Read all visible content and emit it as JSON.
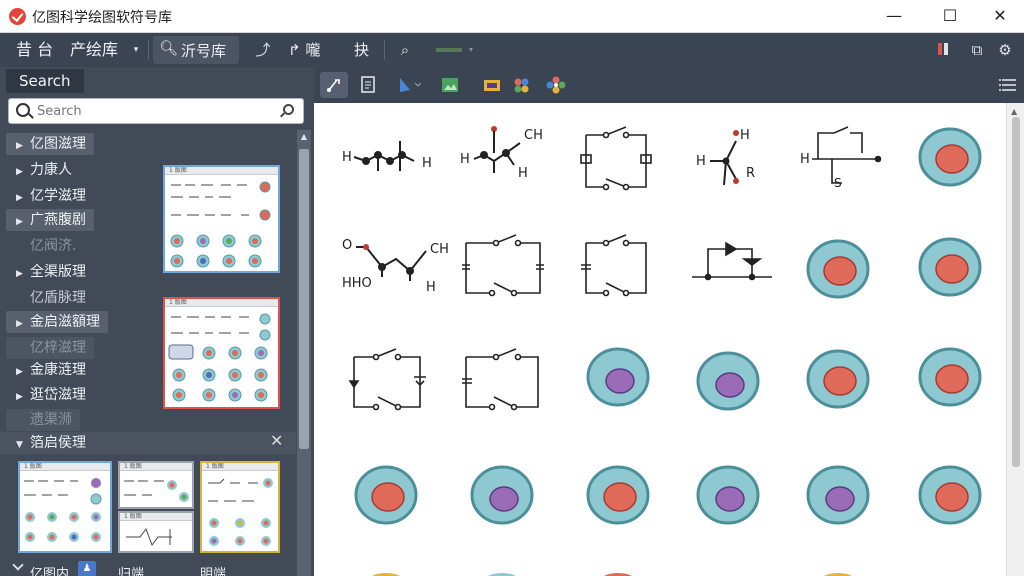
{
  "window": {
    "title": "亿图科学绘图软符号库",
    "minimize": "—",
    "maximize": "☐",
    "close": "✕"
  },
  "toolbar": {
    "menu_1": "昔 台",
    "menu_2": "产绘库",
    "library": "沂号库",
    "item_4": "↱ 嚨",
    "item_5": "抉"
  },
  "left_panel": {
    "search_tab": "Search",
    "search_placeholder": "Search",
    "categories": [
      {
        "label": "亿图滋理",
        "state": "collapsed"
      },
      {
        "label": "力康人",
        "state": "collapsed"
      },
      {
        "label": "亿学滋理",
        "state": "collapsed"
      },
      {
        "label": "广燕腹剧",
        "state": "collapsed"
      },
      {
        "label": "亿阀济.",
        "state": "dim"
      },
      {
        "label": "全渠版理",
        "state": "collapsed"
      },
      {
        "label": "亿盾脉理",
        "state": "dim"
      },
      {
        "label": "金启滋額理",
        "state": "collapsed"
      },
      {
        "label": "亿梓滋理",
        "state": "dim"
      },
      {
        "label": "金康涟理",
        "state": "collapsed"
      },
      {
        "label": "逛岱滋理",
        "state": "collapsed"
      },
      {
        "label": "遗渠浉",
        "state": "dim"
      },
      {
        "label": "箔启侯理",
        "state": "expanded"
      }
    ],
    "thumb_labels": [
      "1 版图",
      "1 版图",
      "1 版图",
      "1 版图",
      "1 版图",
      "1 版图"
    ],
    "bottom_labels": [
      "亿图内",
      "归端",
      "明端"
    ]
  },
  "colors": {
    "toolbar_bg": "#3b4452",
    "panel_bg": "#414a56",
    "cell_fill": "#8ec9d1",
    "nucleus_red": "#e06a5a",
    "nucleus_purple": "#9a6cb8"
  }
}
